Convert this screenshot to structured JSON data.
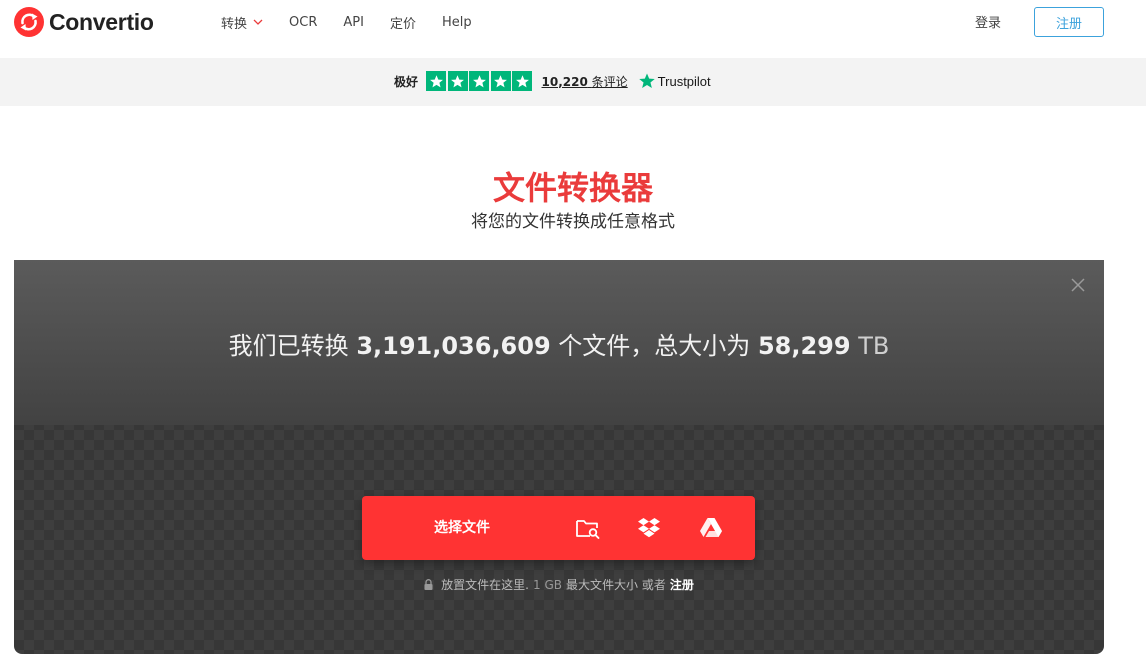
{
  "header": {
    "brand": "Convertio",
    "nav": [
      {
        "label": "转换",
        "has_dropdown": true
      },
      {
        "label": "OCR"
      },
      {
        "label": "API"
      },
      {
        "label": "定价"
      },
      {
        "label": "Help"
      }
    ],
    "login": "登录",
    "signup": "注册"
  },
  "trustpilot": {
    "rating": "极好",
    "stars": 5,
    "review_count": "10,220",
    "review_suffix": "条评论",
    "brand": "Trustpilot"
  },
  "hero": {
    "title": "文件转换器",
    "subtitle": "将您的文件转换成任意格式"
  },
  "stats": {
    "prefix": "我们已转换",
    "file_count": "3,191,036,609",
    "mid": "个文件，总大小为",
    "total_size": "58,299",
    "unit": "TB"
  },
  "upload": {
    "label": "选择文件"
  },
  "hint": {
    "text": "放置文件在这里.",
    "size": "1 GB",
    "size_suffix": "最大文件大小 或者",
    "register": "注册"
  },
  "colors": {
    "brand_red": "#ff3333",
    "title_red": "#ea3b3b",
    "signup_blue": "#3ca2dc",
    "trustpilot_green": "#00b67a"
  }
}
